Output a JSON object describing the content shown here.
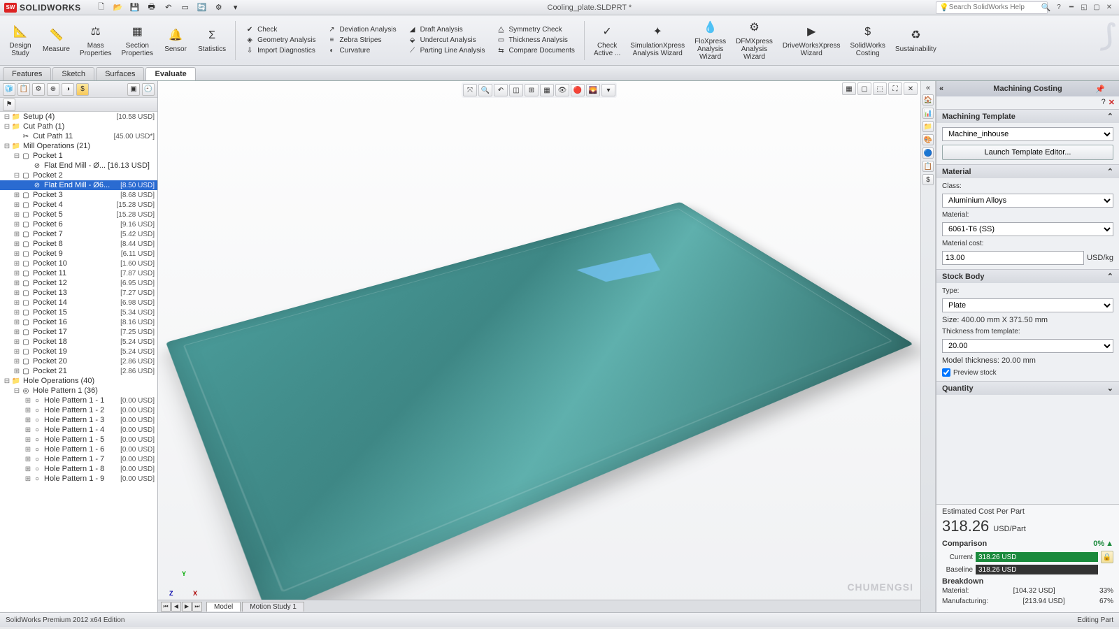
{
  "app": {
    "name": "SOLIDWORKS",
    "doc": "Cooling_plate.SLDPRT *",
    "search_placeholder": "Search SolidWorks Help"
  },
  "ribbon": {
    "large": [
      {
        "label": "Design\nStudy",
        "icon": "📐"
      },
      {
        "label": "Measure",
        "icon": "📏"
      },
      {
        "label": "Mass\nProperties",
        "icon": "⚖"
      },
      {
        "label": "Section\nProperties",
        "icon": "▦"
      },
      {
        "label": "Sensor",
        "icon": "🔔"
      },
      {
        "label": "Statistics",
        "icon": "Σ"
      }
    ],
    "col1": [
      {
        "label": "Check",
        "icon": "✔"
      },
      {
        "label": "Geometry Analysis",
        "icon": "◈"
      },
      {
        "label": "Import Diagnostics",
        "icon": "⇩"
      }
    ],
    "col2": [
      {
        "label": "Deviation Analysis",
        "icon": "↗"
      },
      {
        "label": "Zebra Stripes",
        "icon": "≡"
      },
      {
        "label": "Curvature",
        "icon": "◐"
      }
    ],
    "col3": [
      {
        "label": "Draft Analysis",
        "icon": "◢"
      },
      {
        "label": "Undercut Analysis",
        "icon": "⬙"
      },
      {
        "label": "Parting Line Analysis",
        "icon": "⟋"
      }
    ],
    "col4": [
      {
        "label": "Symmetry Check",
        "icon": "⧋"
      },
      {
        "label": "Thickness Analysis",
        "icon": "▭"
      },
      {
        "label": "Compare Documents",
        "icon": "⇆"
      }
    ],
    "large2": [
      {
        "label": "Check\nActive ...",
        "icon": "✓"
      },
      {
        "label": "SimulationXpress\nAnalysis Wizard",
        "icon": "✦"
      },
      {
        "label": "FloXpress\nAnalysis\nWizard",
        "icon": "💧"
      },
      {
        "label": "DFMXpress\nAnalysis\nWizard",
        "icon": "⚙"
      },
      {
        "label": "DriveWorksXpress\nWizard",
        "icon": "▶"
      },
      {
        "label": "SolidWorks\nCosting",
        "icon": "$"
      },
      {
        "label": "Sustainability",
        "icon": "♻"
      }
    ]
  },
  "tabs": [
    "Features",
    "Sketch",
    "Surfaces",
    "Evaluate"
  ],
  "active_tab": "Evaluate",
  "tree": [
    {
      "ind": 0,
      "exp": "⊟",
      "ico": "📁",
      "label": "Setup (4)",
      "cost": "[10.58 USD]"
    },
    {
      "ind": 0,
      "exp": "⊟",
      "ico": "📁",
      "label": "Cut Path (1)",
      "cost": ""
    },
    {
      "ind": 1,
      "exp": "",
      "ico": "✂",
      "label": "Cut Path 11",
      "cost": "[45.00 USD*]"
    },
    {
      "ind": 0,
      "exp": "⊟",
      "ico": "📁",
      "label": "Mill Operations (21)",
      "cost": ""
    },
    {
      "ind": 1,
      "exp": "⊟",
      "ico": "▢",
      "label": "Pocket 1",
      "cost": ""
    },
    {
      "ind": 2,
      "exp": "",
      "ico": "⊘",
      "label": "Flat End Mill - Ø... [16.13 USD]",
      "cost": ""
    },
    {
      "ind": 1,
      "exp": "⊟",
      "ico": "▢",
      "label": "Pocket 2",
      "cost": ""
    },
    {
      "ind": 2,
      "exp": "",
      "ico": "⊘",
      "label": "Flat End Mill - Ø6...",
      "cost": "[8.50 USD]",
      "sel": true
    },
    {
      "ind": 1,
      "exp": "⊞",
      "ico": "▢",
      "label": "Pocket 3",
      "cost": "[8.68 USD]"
    },
    {
      "ind": 1,
      "exp": "⊞",
      "ico": "▢",
      "label": "Pocket 4",
      "cost": "[15.28 USD]"
    },
    {
      "ind": 1,
      "exp": "⊞",
      "ico": "▢",
      "label": "Pocket 5",
      "cost": "[15.28 USD]"
    },
    {
      "ind": 1,
      "exp": "⊞",
      "ico": "▢",
      "label": "Pocket 6",
      "cost": "[9.16 USD]"
    },
    {
      "ind": 1,
      "exp": "⊞",
      "ico": "▢",
      "label": "Pocket 7",
      "cost": "[5.42 USD]"
    },
    {
      "ind": 1,
      "exp": "⊞",
      "ico": "▢",
      "label": "Pocket 8",
      "cost": "[8.44 USD]"
    },
    {
      "ind": 1,
      "exp": "⊞",
      "ico": "▢",
      "label": "Pocket 9",
      "cost": "[6.11 USD]"
    },
    {
      "ind": 1,
      "exp": "⊞",
      "ico": "▢",
      "label": "Pocket 10",
      "cost": "[1.60 USD]"
    },
    {
      "ind": 1,
      "exp": "⊞",
      "ico": "▢",
      "label": "Pocket 11",
      "cost": "[7.87 USD]"
    },
    {
      "ind": 1,
      "exp": "⊞",
      "ico": "▢",
      "label": "Pocket 12",
      "cost": "[6.95 USD]"
    },
    {
      "ind": 1,
      "exp": "⊞",
      "ico": "▢",
      "label": "Pocket 13",
      "cost": "[7.27 USD]"
    },
    {
      "ind": 1,
      "exp": "⊞",
      "ico": "▢",
      "label": "Pocket 14",
      "cost": "[6.98 USD]"
    },
    {
      "ind": 1,
      "exp": "⊞",
      "ico": "▢",
      "label": "Pocket 15",
      "cost": "[5.34 USD]"
    },
    {
      "ind": 1,
      "exp": "⊞",
      "ico": "▢",
      "label": "Pocket 16",
      "cost": "[8.16 USD]"
    },
    {
      "ind": 1,
      "exp": "⊞",
      "ico": "▢",
      "label": "Pocket 17",
      "cost": "[7.25 USD]"
    },
    {
      "ind": 1,
      "exp": "⊞",
      "ico": "▢",
      "label": "Pocket 18",
      "cost": "[5.24 USD]"
    },
    {
      "ind": 1,
      "exp": "⊞",
      "ico": "▢",
      "label": "Pocket 19",
      "cost": "[5.24 USD]"
    },
    {
      "ind": 1,
      "exp": "⊞",
      "ico": "▢",
      "label": "Pocket 20",
      "cost": "[2.86 USD]"
    },
    {
      "ind": 1,
      "exp": "⊞",
      "ico": "▢",
      "label": "Pocket 21",
      "cost": "[2.86 USD]"
    },
    {
      "ind": 0,
      "exp": "⊟",
      "ico": "📁",
      "label": "Hole Operations (40)",
      "cost": ""
    },
    {
      "ind": 1,
      "exp": "⊟",
      "ico": "◎",
      "label": "Hole Pattern 1 (36)",
      "cost": ""
    },
    {
      "ind": 2,
      "exp": "⊞",
      "ico": "○",
      "label": "Hole Pattern 1 - 1",
      "cost": "[0.00 USD]"
    },
    {
      "ind": 2,
      "exp": "⊞",
      "ico": "○",
      "label": "Hole Pattern 1 - 2",
      "cost": "[0.00 USD]"
    },
    {
      "ind": 2,
      "exp": "⊞",
      "ico": "○",
      "label": "Hole Pattern 1 - 3",
      "cost": "[0.00 USD]"
    },
    {
      "ind": 2,
      "exp": "⊞",
      "ico": "○",
      "label": "Hole Pattern 1 - 4",
      "cost": "[0.00 USD]"
    },
    {
      "ind": 2,
      "exp": "⊞",
      "ico": "○",
      "label": "Hole Pattern 1 - 5",
      "cost": "[0.00 USD]"
    },
    {
      "ind": 2,
      "exp": "⊞",
      "ico": "○",
      "label": "Hole Pattern 1 - 6",
      "cost": "[0.00 USD]"
    },
    {
      "ind": 2,
      "exp": "⊞",
      "ico": "○",
      "label": "Hole Pattern 1 - 7",
      "cost": "[0.00 USD]"
    },
    {
      "ind": 2,
      "exp": "⊞",
      "ico": "○",
      "label": "Hole Pattern 1 - 8",
      "cost": "[0.00 USD]"
    },
    {
      "ind": 2,
      "exp": "⊞",
      "ico": "○",
      "label": "Hole Pattern 1 - 9",
      "cost": "[0.00 USD]"
    }
  ],
  "bottom_tabs": [
    "Model",
    "Motion Study 1"
  ],
  "task": {
    "title": "Machining Costing",
    "template_head": "Machining Template",
    "template_select": "Machine_inhouse",
    "template_btn": "Launch Template Editor...",
    "material_head": "Material",
    "class_lbl": "Class:",
    "class_val": "Aluminium Alloys",
    "mat_lbl": "Material:",
    "mat_val": "6061-T6 (SS)",
    "cost_lbl": "Material cost:",
    "cost_val": "13.00",
    "cost_unit": "USD/kg",
    "stock_head": "Stock Body",
    "type_lbl": "Type:",
    "type_val": "Plate",
    "size_lbl": "Size: 400.00 mm X 371.50 mm",
    "thick_lbl": "Thickness from template:",
    "thick_val": "20.00",
    "model_thick": "Model thickness: 20.00 mm",
    "preview": "Preview stock",
    "qty_head": "Quantity"
  },
  "cost": {
    "head": "Estimated Cost Per Part",
    "value": "318.26",
    "unit": "USD/Part",
    "comparison": "Comparison",
    "pct": "0%",
    "current_lbl": "Current",
    "current_val": "318.26 USD",
    "baseline_lbl": "Baseline",
    "baseline_val": "318.26 USD",
    "breakdown": "Breakdown",
    "rows": [
      {
        "label": "Material:",
        "val": "[104.32 USD]",
        "pct": "33%"
      },
      {
        "label": "Manufacturing:",
        "val": "[213.94 USD]",
        "pct": "67%"
      }
    ]
  },
  "status": {
    "left": "SolidWorks Premium 2012 x64 Edition",
    "right": "Editing Part"
  },
  "watermark": "CHUMENGSI"
}
